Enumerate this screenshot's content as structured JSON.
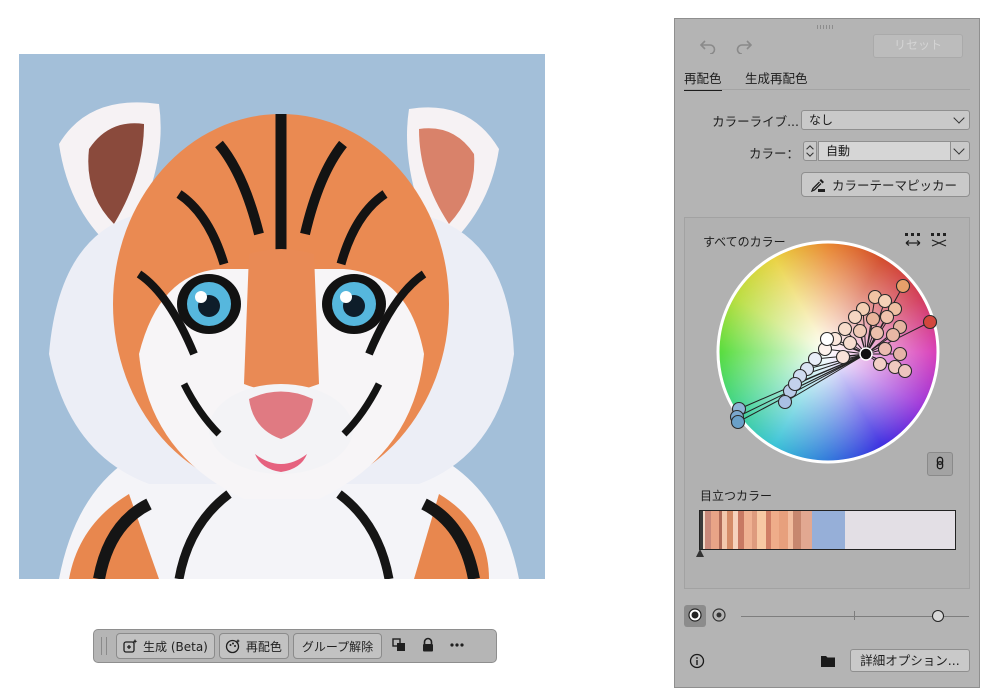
{
  "colors": {
    "artboard_bg": "#a3bfd9",
    "panel_bg": "#b4b4b4",
    "wheel_marker_selected": "#d3473e"
  },
  "artwork": {
    "subject": "tiger-cub-illustration"
  },
  "taskbar": {
    "generate_label": "生成 (Beta)",
    "recolor_label": "再配色",
    "ungroup_label": "グループ解除",
    "icons": [
      "generate-icon",
      "recolor-icon",
      "arrange-icon",
      "lock-icon",
      "more-icon"
    ]
  },
  "panel": {
    "reset_label": "リセット",
    "tabs": [
      {
        "label": "再配色",
        "active": true
      },
      {
        "label": "生成再配色",
        "active": false
      }
    ],
    "color_library": {
      "label": "カラーライブ...",
      "value": "なし"
    },
    "colors_field": {
      "label": "カラー：",
      "value": "自動"
    },
    "picker_label": "カラーテーマピッカー",
    "all_colors_label": "すべてのカラー",
    "prominent_label": "目立つカラー",
    "prominent_swatches": [
      {
        "color": "#3a3a3a",
        "weight": 1
      },
      {
        "color": "#f0d9c8",
        "weight": 1
      },
      {
        "color": "#c9897a",
        "weight": 2
      },
      {
        "color": "#e8a487",
        "weight": 3
      },
      {
        "color": "#b06b58",
        "weight": 1
      },
      {
        "color": "#f3c8ad",
        "weight": 2
      },
      {
        "color": "#d48c68",
        "weight": 2
      },
      {
        "color": "#f6d2bd",
        "weight": 2
      },
      {
        "color": "#c87963",
        "weight": 2
      },
      {
        "color": "#efb192",
        "weight": 3
      },
      {
        "color": "#de9b7e",
        "weight": 2
      },
      {
        "color": "#f7c9a4",
        "weight": 3
      },
      {
        "color": "#d07f66",
        "weight": 2
      },
      {
        "color": "#efad8a",
        "weight": 3
      },
      {
        "color": "#e7a07d",
        "weight": 3
      },
      {
        "color": "#f2bd9f",
        "weight": 2
      },
      {
        "color": "#c7876f",
        "weight": 3
      },
      {
        "color": "#e2a891",
        "weight": 4
      },
      {
        "color": "#96afd8",
        "weight": 12
      },
      {
        "color": "#e3dfe5",
        "weight": 40
      }
    ],
    "advanced_label": "詳細オプション..."
  }
}
